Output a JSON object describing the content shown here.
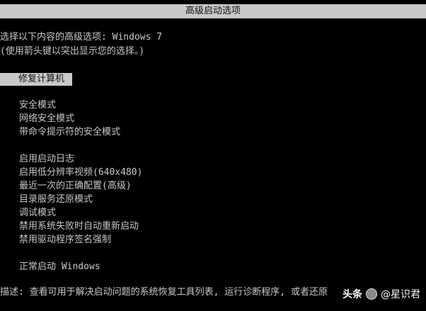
{
  "title": "高级启动选项",
  "intro": {
    "line1": "选择以下内容的高级选项: Windows 7",
    "line2": "(使用箭头键以突出显示您的选择。)"
  },
  "selected_option": "修复计算机",
  "options": {
    "safe_mode": "安全模式",
    "safe_mode_network": "网络安全模式",
    "safe_mode_cmd": "带命令提示符的安全模式",
    "boot_logging": "启用启动日志",
    "low_res_video": "启用低分辨率视频(640x480)",
    "last_known_good": "最近一次的正确配置(高级)",
    "dsrm": "目录服务还原模式",
    "debug_mode": "调试模式",
    "disable_auto_restart": "禁用系统失败时自动重新启动",
    "disable_driver_sign": "禁用驱动程序签名强制",
    "start_normally": "正常启动 Windows"
  },
  "description": "描述: 查看可用于解决启动问题的系统恢复工具列表, 运行诊断程序, 或者还原",
  "watermark": {
    "logo": "头条",
    "author": "@星识君"
  },
  "colors": {
    "background": "#000000",
    "text": "#c8c8c8",
    "highlight_bg": "#c9c9c9",
    "highlight_text": "#111111"
  }
}
